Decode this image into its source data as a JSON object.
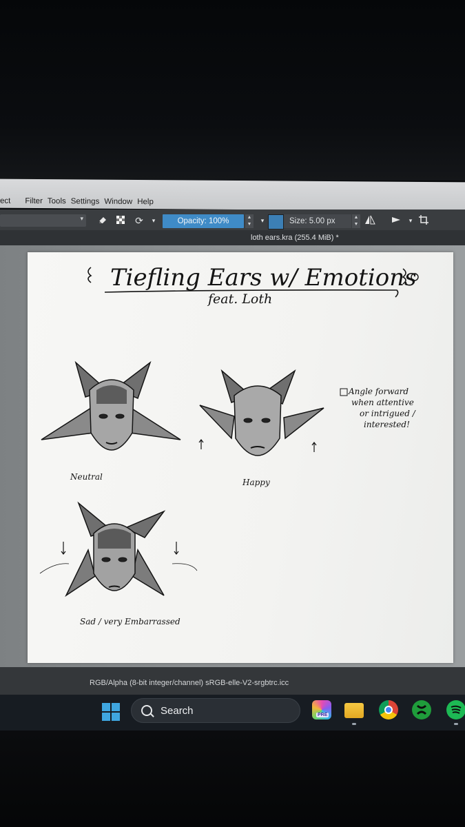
{
  "menubar": {
    "items": [
      "ect",
      "Filter",
      "Tools",
      "Settings",
      "Window",
      "Help"
    ]
  },
  "toolbar": {
    "opacity_label": "Opacity: 100%",
    "size_label": "Size: 5.00 px",
    "brush_color": "#3c7fb5",
    "icons": [
      "eraser-icon",
      "alpha-lock-icon",
      "reload-preset-icon",
      "dropdown-icon",
      "mirror-horizontal-icon",
      "mirror-vertical-icon",
      "crop-icon"
    ]
  },
  "document": {
    "title": "loth ears.kra (255.4 MiB) *"
  },
  "canvas": {
    "heading": "Tiefling Ears w/ Emotions",
    "subheading": "feat. Loth",
    "labels": {
      "neutral": "Neutral",
      "happy": "Happy",
      "sad": "Sad / very Embarrassed"
    },
    "note": [
      "Angle forward",
      "when attentive",
      "or intrigued /",
      "interested!"
    ]
  },
  "statusbar": {
    "text": "RGB/Alpha (8-bit integer/channel)  sRGB-elle-V2-srgbtrc.icc"
  },
  "taskbar": {
    "search_label": "Search",
    "badge": "PRE",
    "accent": "#3fa6e0",
    "icons": [
      "windows-start-icon",
      "copilot-icon",
      "file-explorer-icon",
      "chrome-icon",
      "xbox-icon",
      "spotify-icon"
    ]
  }
}
